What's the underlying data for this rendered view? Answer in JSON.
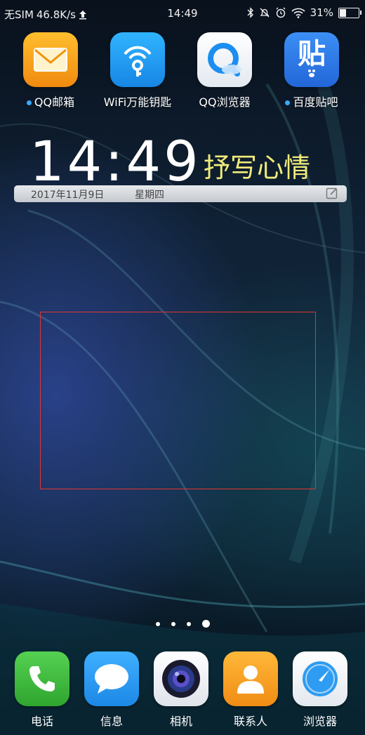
{
  "status_bar": {
    "carrier": "无SIM",
    "net_speed": "46.8K/s",
    "time": "14:49",
    "battery_percent": "31%",
    "battery_level": 0.31
  },
  "top_apps": [
    {
      "label": "QQ邮箱",
      "has_dot": true,
      "icon": "mail-icon",
      "color": "#f4a21a"
    },
    {
      "label": "WiFi万能钥匙",
      "has_dot": false,
      "icon": "wifi-key-icon",
      "color": "#1e9ff0"
    },
    {
      "label": "QQ浏览器",
      "has_dot": false,
      "icon": "qq-browser-icon",
      "color": "#ffffff"
    },
    {
      "label": "百度贴吧",
      "has_dot": true,
      "icon": "tieba-icon",
      "color": "#2f7ff0"
    }
  ],
  "tieba_glyph": "贴",
  "clock_widget": {
    "time": "14:49",
    "mood": "抒写心情",
    "date": "2017年11月9日",
    "weekday": "星期四"
  },
  "dock": [
    {
      "label": "电话",
      "icon": "phone-icon",
      "color": "#3dbb3d"
    },
    {
      "label": "信息",
      "icon": "message-icon",
      "color": "#2c9ff0"
    },
    {
      "label": "相机",
      "icon": "camera-icon",
      "color": "#ffffff"
    },
    {
      "label": "联系人",
      "icon": "contacts-icon",
      "color": "#f7a51f"
    },
    {
      "label": "浏览器",
      "icon": "browser-icon",
      "color": "#ffffff"
    }
  ],
  "page_indicator": {
    "count": 4,
    "active": 4
  },
  "colors": {
    "accent_dot": "#3aa8ff",
    "mood_text": "#f1ec7a",
    "selection": "#e2352f"
  }
}
